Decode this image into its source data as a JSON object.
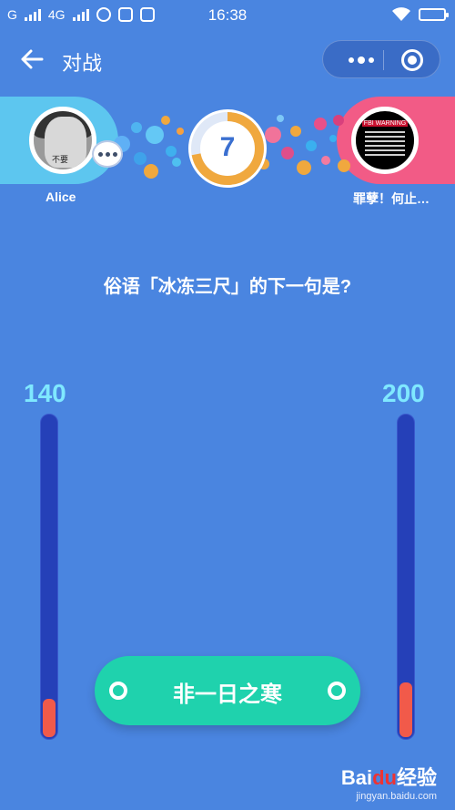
{
  "status_bar": {
    "carrier_left": "G",
    "network": "4G",
    "time": "16:38",
    "icons": [
      "signal-icon",
      "signal-icon",
      "qq-icon",
      "alipay-icon",
      "notification-icon",
      "wifi-icon",
      "battery-icon"
    ]
  },
  "header": {
    "back_icon": "arrow-left-icon",
    "title": "对战",
    "menu_icon": "more-dots-icon",
    "close_icon": "target-circle-icon"
  },
  "players": {
    "left": {
      "name": "Alice",
      "score": "140",
      "score_fraction": 0.12,
      "avatar_text": "不要"
    },
    "right": {
      "name": "罪孽！何止…",
      "score": "200",
      "score_fraction": 0.17,
      "avatar_text": "FBI WARNING"
    }
  },
  "timer": {
    "value": "7",
    "progress_fraction": 0.72,
    "color": "#f0a83e"
  },
  "question": "俗语「冰冻三尺」的下一句是?",
  "answer_option": "非一日之寒",
  "watermark": {
    "brand": "Bai",
    "brand_highlight": "du",
    "suffix": "经验",
    "site": "jingyan.baidu.com"
  },
  "colors": {
    "background": "#4a85e0",
    "left_banner": "#5dc6ef",
    "right_banner": "#f25b86",
    "score_text": "#7fe8ff",
    "answer_button": "#1fd2ad",
    "score_fill": "#f15a4a"
  }
}
